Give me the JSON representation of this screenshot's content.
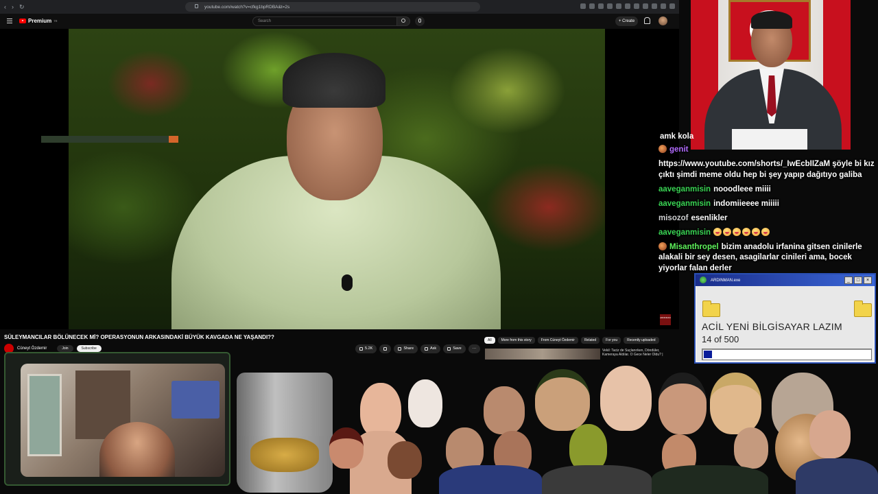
{
  "browser": {
    "url": "youtube.com/watch?v=cfkg1bpRDBA&t=2s"
  },
  "header": {
    "logo_text": "Premium",
    "logo_sup": "TR",
    "search_placeholder": "Search",
    "create_label": "+ Create"
  },
  "video": {
    "title": "SÜLEYMANCILAR BÖLÜNECEK Mİ? OPERASYONUN ARKASINDAKİ BÜYÜK KAVGADA NE YAŞANDI??",
    "channel_name": "Cüneyt Özdemir",
    "join_label": "Join",
    "subscribe_label": "Subscribe",
    "like_count": "5.2K",
    "share_label": "Share",
    "ask_label": "Ask",
    "save_label": "Save",
    "more_label": "···",
    "badge_text": "ARDINDAN"
  },
  "chips": [
    "All",
    "More from this story",
    "From Cüneyt Özdemir",
    "Related",
    "For you",
    "Recently uploaded"
  ],
  "recommendation": {
    "title": "Vekil: Taciz de Suçlanırken, Döndüler, Kameraya Aldılar. O Gece Neler Oldu? |"
  },
  "chat": {
    "first_line": "amk kola",
    "messages": [
      {
        "user": "genit",
        "text": "",
        "badge": true,
        "user_style": "violet"
      },
      {
        "user": "",
        "text": "https://www.youtube.com/shorts/_IwEcbIIZaM şöyle bi kız çıktı şimdi meme oldu hep bi şey yapıp dağıtıyo galiba",
        "badge": false,
        "user_style": "green"
      },
      {
        "user": "aaveganmisin",
        "text": "nooodleee miiii",
        "badge": false,
        "user_style": "green"
      },
      {
        "user": "aaveganmisin",
        "text": "indomiieeee miiiii",
        "badge": false,
        "user_style": "green"
      },
      {
        "user": "misozof",
        "text": "esenlikler",
        "badge": false,
        "user_style": "grey"
      },
      {
        "user": "aaveganmisin",
        "text": "",
        "emojis": 6,
        "badge": false,
        "user_style": "green"
      },
      {
        "user": "Misanthropel",
        "text": "bizim anadolu irfanina gitsen cinilerle alakali bir sey desen, asagilarlar cinileri ama, bocek yiyorlar falan derler",
        "badge": true,
        "user_style": "green2"
      }
    ]
  },
  "retro_window": {
    "title": "ARDINMAN.exe",
    "message": "ACİL YENİ BİLGİSAYAR LAZIM",
    "count_text": "14 of 500",
    "progress_fraction": 0.028,
    "title_buttons": [
      "_",
      "□",
      "×"
    ]
  },
  "colors": {
    "youtube_red": "#ff0000",
    "chat_green": "#39d353",
    "retro_titlebar": "#1a2d8a",
    "progress_fill": "#0a1d9a"
  }
}
